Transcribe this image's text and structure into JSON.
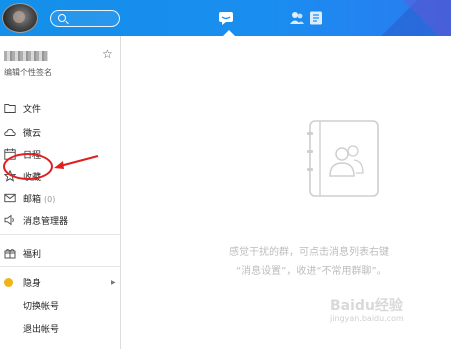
{
  "profile": {
    "signature": "编辑个性签名"
  },
  "nav": {
    "items": [
      {
        "label": "文件",
        "icon": "folder-icon"
      },
      {
        "label": "微云",
        "icon": "cloud-icon"
      },
      {
        "label": "日程",
        "icon": "calendar-icon"
      },
      {
        "label": "收藏",
        "icon": "star-icon"
      },
      {
        "label": "邮箱",
        "count": "(0)",
        "icon": "mail-icon"
      },
      {
        "label": "消息管理器",
        "icon": "speaker-icon"
      },
      {
        "label": "福利",
        "icon": "gift-icon"
      },
      {
        "label": "隐身",
        "icon": "status-dot-icon"
      },
      {
        "label": "切换帐号"
      },
      {
        "label": "退出帐号"
      }
    ]
  },
  "main": {
    "empty_hint_line1": "感觉干扰的群，可点击消息列表右键",
    "empty_hint_line2": "“消息设置”，收进“不常用群聊”。"
  },
  "colors": {
    "topbar": "#1a8df0",
    "annotation": "#e02020",
    "status_hidden": "#f0b515"
  },
  "watermark": {
    "brand": "Baidu经验",
    "url": "jingyan.baidu.com"
  }
}
